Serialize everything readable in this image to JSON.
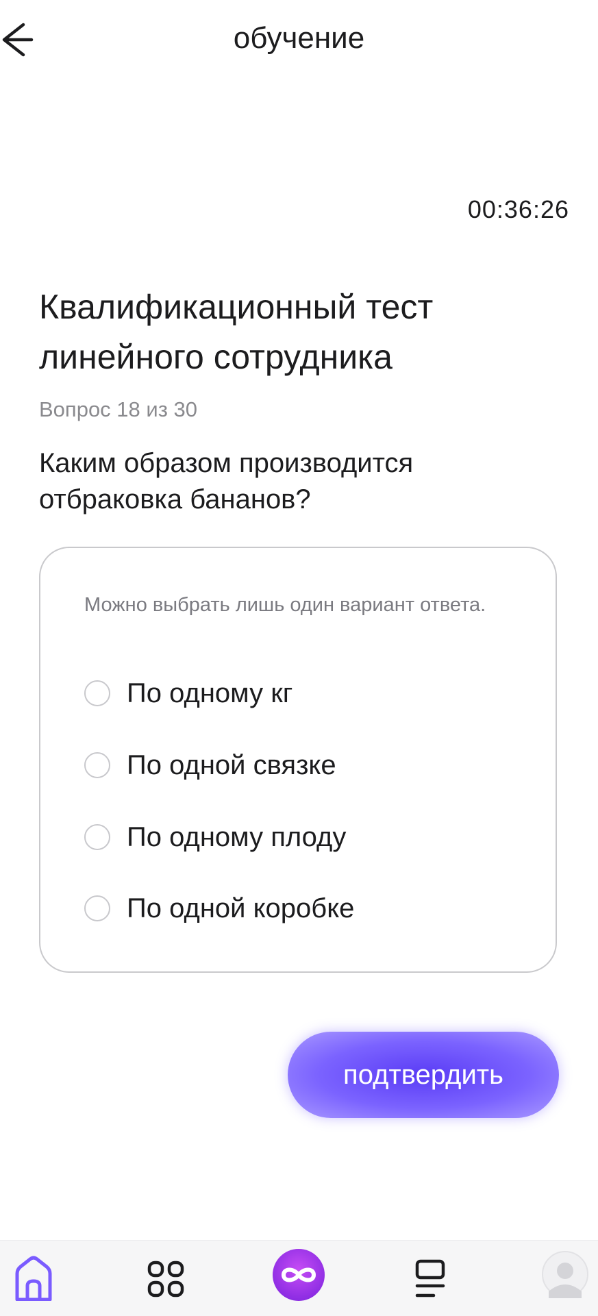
{
  "header": {
    "title": "обучение",
    "back_icon": "arrow-left-icon"
  },
  "timer": "00:36:26",
  "test": {
    "title": "Квалификационный тест линейного сотрудника",
    "progress": "Вопрос 18 из 30",
    "question": "Каким образом производится отбраковка бананов?"
  },
  "answers": {
    "hint": "Можно выбрать лишь один вариант ответа.",
    "options": [
      {
        "label": "По одному кг"
      },
      {
        "label": "По одной связке"
      },
      {
        "label": "По одному плоду"
      },
      {
        "label": "По одной коробке"
      }
    ]
  },
  "confirm_label": "подтвердить",
  "bottom_nav": {
    "items": [
      {
        "icon": "home-icon",
        "active": true
      },
      {
        "icon": "apps-grid-icon"
      },
      {
        "icon": "infinity-icon"
      },
      {
        "icon": "list-icon"
      },
      {
        "icon": "avatar-icon"
      }
    ]
  },
  "colors": {
    "accent": "#6a4ff7",
    "accent_nav": "#7a5bff",
    "center_button": "#b43cf0",
    "text_primary": "#1c1c1e",
    "text_secondary": "#8a8a8e",
    "border": "#c9c9cc"
  }
}
